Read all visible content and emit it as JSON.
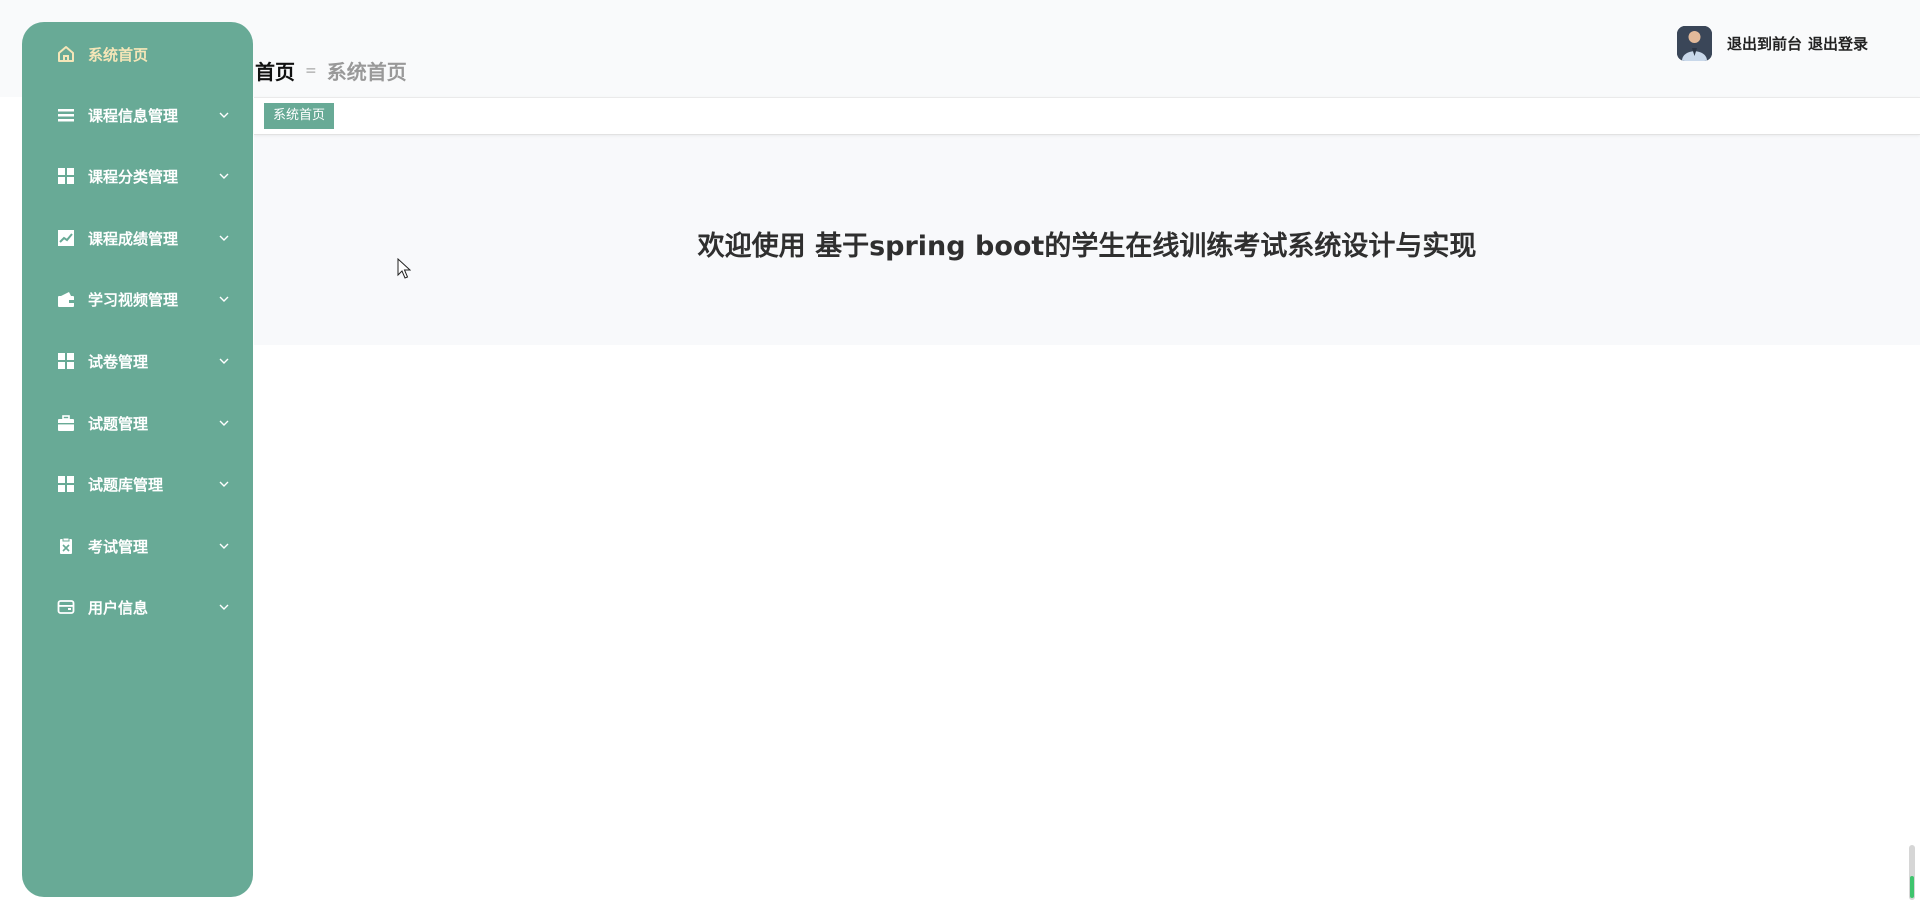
{
  "breadcrumb": {
    "home": "首页",
    "separator": "=",
    "current": "系统首页"
  },
  "user": {
    "back_to_front": "退出到前台",
    "logout": "退出登录"
  },
  "tabs": [
    {
      "label": "系统首页"
    }
  ],
  "welcome": "欢迎使用 基于spring boot的学生在线训练考试系统设计与实现",
  "sidebar": {
    "items": [
      {
        "label": "系统首页",
        "icon": "home-icon"
      },
      {
        "label": "课程信息管理",
        "icon": "list-icon"
      },
      {
        "label": "课程分类管理",
        "icon": "grid-icon"
      },
      {
        "label": "课程成绩管理",
        "icon": "chart-icon"
      },
      {
        "label": "学习视频管理",
        "icon": "wallet-icon"
      },
      {
        "label": "试卷管理",
        "icon": "grid-icon"
      },
      {
        "label": "试题管理",
        "icon": "briefcase-icon"
      },
      {
        "label": "试题库管理",
        "icon": "grid-icon"
      },
      {
        "label": "考试管理",
        "icon": "clipboard-icon"
      },
      {
        "label": "用户信息",
        "icon": "card-icon"
      }
    ]
  },
  "colors": {
    "sidebar": "#68aa96",
    "active_text": "#f5e6b8",
    "scroll_thumb": "#3ec46d"
  }
}
